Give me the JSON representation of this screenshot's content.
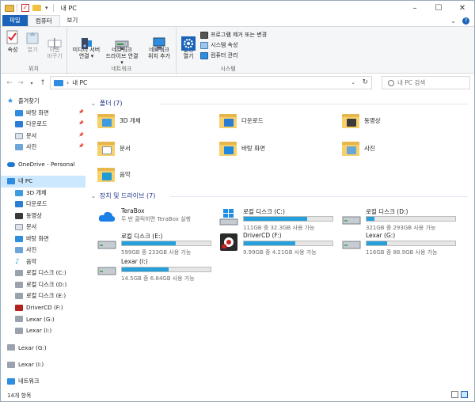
{
  "window": {
    "title": "내 PC",
    "controls": [
      "minimize-icon",
      "maximize-icon",
      "close-icon"
    ]
  },
  "ribbon_tabs": [
    "파일",
    "컴퓨터",
    "보기"
  ],
  "ribbon": {
    "location": {
      "group_label": "위치",
      "buttons": [
        {
          "label": "속성",
          "icon": "properties-icon",
          "enabled": true
        },
        {
          "label": "열기",
          "icon": "open-icon",
          "enabled": false
        },
        {
          "label": "이름\n바꾸기",
          "icon": "rename-icon",
          "enabled": false
        }
      ]
    },
    "network": {
      "group_label": "네트워크",
      "buttons": [
        {
          "label": "미디어 서버\n연결 ▾",
          "icon": "media-server-icon"
        },
        {
          "label": "네트워크\n드라이브 연결 ▾",
          "icon": "map-network-drive-icon"
        },
        {
          "label": "네트워크\n위치 추가",
          "icon": "add-network-location-icon"
        }
      ]
    },
    "system": {
      "group_label": "시스템",
      "settings_label": "설정\n열기",
      "items": [
        "프로그램 제거 또는 변경",
        "시스템 속성",
        "컴퓨터 관리"
      ]
    }
  },
  "address": {
    "path": "내 PC",
    "search_placeholder": "내 PC 검색"
  },
  "sidebar": [
    {
      "label": "즐겨찾기",
      "icon": "star-icon",
      "top": true
    },
    {
      "label": "바탕 화면",
      "icon": "desktop-icon",
      "pinned": true
    },
    {
      "label": "다운로드",
      "icon": "download-icon",
      "pinned": true
    },
    {
      "label": "문서",
      "icon": "documents-icon",
      "pinned": true
    },
    {
      "label": "사진",
      "icon": "pictures-icon",
      "pinned": true
    },
    {
      "gap": true
    },
    {
      "label": "OneDrive - Personal",
      "icon": "onedrive-icon",
      "top": true
    },
    {
      "gap": true
    },
    {
      "label": "내 PC",
      "icon": "pc-icon",
      "top": true,
      "selected": true
    },
    {
      "label": "3D 개체",
      "icon": "3d-objects-icon"
    },
    {
      "label": "다운로드",
      "icon": "download-icon"
    },
    {
      "label": "동영상",
      "icon": "videos-icon"
    },
    {
      "label": "문서",
      "icon": "documents-icon"
    },
    {
      "label": "바탕 화면",
      "icon": "desktop-icon"
    },
    {
      "label": "사진",
      "icon": "pictures-icon"
    },
    {
      "label": "음악",
      "icon": "music-icon"
    },
    {
      "label": "로컬 디스크 (C:)",
      "icon": "drive-icon"
    },
    {
      "label": "로컬 디스크 (D:)",
      "icon": "drive-icon"
    },
    {
      "label": "로컬 디스크 (E:)",
      "icon": "drive-icon"
    },
    {
      "label": "DriverCD (F:)",
      "icon": "drivercd-icon"
    },
    {
      "label": "Lexar (G:)",
      "icon": "drive-icon"
    },
    {
      "label": "Lexar (I:)",
      "icon": "drive-icon"
    },
    {
      "gap": true
    },
    {
      "label": "Lexar (G:)",
      "icon": "drive-icon",
      "top": true
    },
    {
      "gap": true
    },
    {
      "label": "Lexar (I:)",
      "icon": "drive-icon",
      "top": true
    },
    {
      "gap": true
    },
    {
      "label": "네트워크",
      "icon": "network-icon",
      "top": true
    }
  ],
  "folders_section": {
    "title": "폴더 (7)",
    "items": [
      {
        "label": "3D 개체",
        "icon": "3d-objects-icon",
        "color": "#3d9be0"
      },
      {
        "label": "다운로드",
        "icon": "download-icon",
        "color": "#2b7cd3"
      },
      {
        "label": "동영상",
        "icon": "videos-icon",
        "color": "#3a3a3a"
      },
      {
        "label": "문서",
        "icon": "documents-icon",
        "color": "#ffffff"
      },
      {
        "label": "바탕 화면",
        "icon": "desktop-icon",
        "color": "#1f8ae0"
      },
      {
        "label": "사진",
        "icon": "pictures-icon",
        "color": "#6aa6d8"
      },
      {
        "label": "음악",
        "icon": "music-icon",
        "color": "#1f9ad6"
      }
    ]
  },
  "drives_section": {
    "title": "장치 및 드라이브 (7)",
    "items": [
      {
        "name": "TeraBox",
        "sub": "두 번 클릭하면 TeraBox 실행",
        "icon": "terabox-icon",
        "fill": null
      },
      {
        "name": "로컬 디스크 (C:)",
        "sub": "111GB 중 32.3GB 사용 가능",
        "icon": "windows-drive-icon",
        "fill": 0.71
      },
      {
        "name": "로컬 디스크 (D:)",
        "sub": "321GB 중 293GB 사용 가능",
        "icon": "drive-icon",
        "fill": 0.09
      },
      {
        "name": "로컬 디스크 (E:)",
        "sub": "599GB 중 233GB 사용 가능",
        "icon": "drive-icon",
        "fill": 0.61
      },
      {
        "name": "DriverCD (F:)",
        "sub": "9.99GB 중 4.21GB 사용 가능",
        "icon": "drivercd-icon",
        "fill": 0.58
      },
      {
        "name": "Lexar (G:)",
        "sub": "116GB 중 88.9GB 사용 가능",
        "icon": "drive-icon",
        "fill": 0.23
      },
      {
        "name": "Lexar (I:)",
        "sub": "14.5GB 중 6.84GB 사용 가능",
        "icon": "drive-icon",
        "fill": 0.53
      }
    ]
  },
  "status": {
    "item_count": "14개 항목"
  },
  "colors": {
    "accent": "#1a63b8",
    "selection": "#cce8ff",
    "bar_fill": "#26a0da",
    "section_header": "#1e3287"
  }
}
